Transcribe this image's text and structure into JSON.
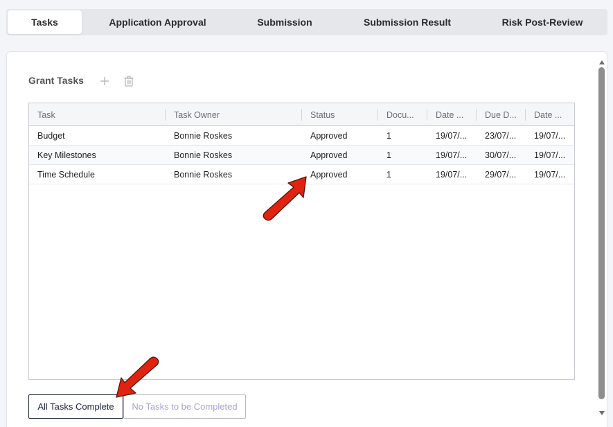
{
  "tabs": [
    {
      "label": "Tasks",
      "active": true
    },
    {
      "label": "Application Approval",
      "active": false
    },
    {
      "label": "Submission",
      "active": false
    },
    {
      "label": "Submission Result",
      "active": false
    },
    {
      "label": "Risk Post-Review",
      "active": false
    }
  ],
  "section": {
    "title": "Grant Tasks",
    "add_icon": "plus-icon",
    "delete_icon": "trash-icon"
  },
  "table": {
    "columns": [
      "Task",
      "Task Owner",
      "Status",
      "Docu...",
      "Date ...",
      "Due D...",
      "Date ..."
    ],
    "rows": [
      [
        "Budget",
        "Bonnie Roskes",
        "Approved",
        "1",
        "19/07/...",
        "23/07/...",
        "19/07/..."
      ],
      [
        "Key Milestones",
        "Bonnie Roskes",
        "Approved",
        "1",
        "19/07/...",
        "30/07/...",
        "19/07/..."
      ],
      [
        "Time Schedule",
        "Bonnie Roskes",
        "Approved",
        "1",
        "19/07/...",
        "29/07/...",
        "19/07/..."
      ]
    ]
  },
  "buttons": {
    "all_complete": "All Tasks Complete",
    "none_to_complete": "No Tasks to be Completed"
  },
  "colors": {
    "annotation_arrow": "#e0230f",
    "primary_border": "#1f2240",
    "disabled_text": "#a9a3d6"
  }
}
